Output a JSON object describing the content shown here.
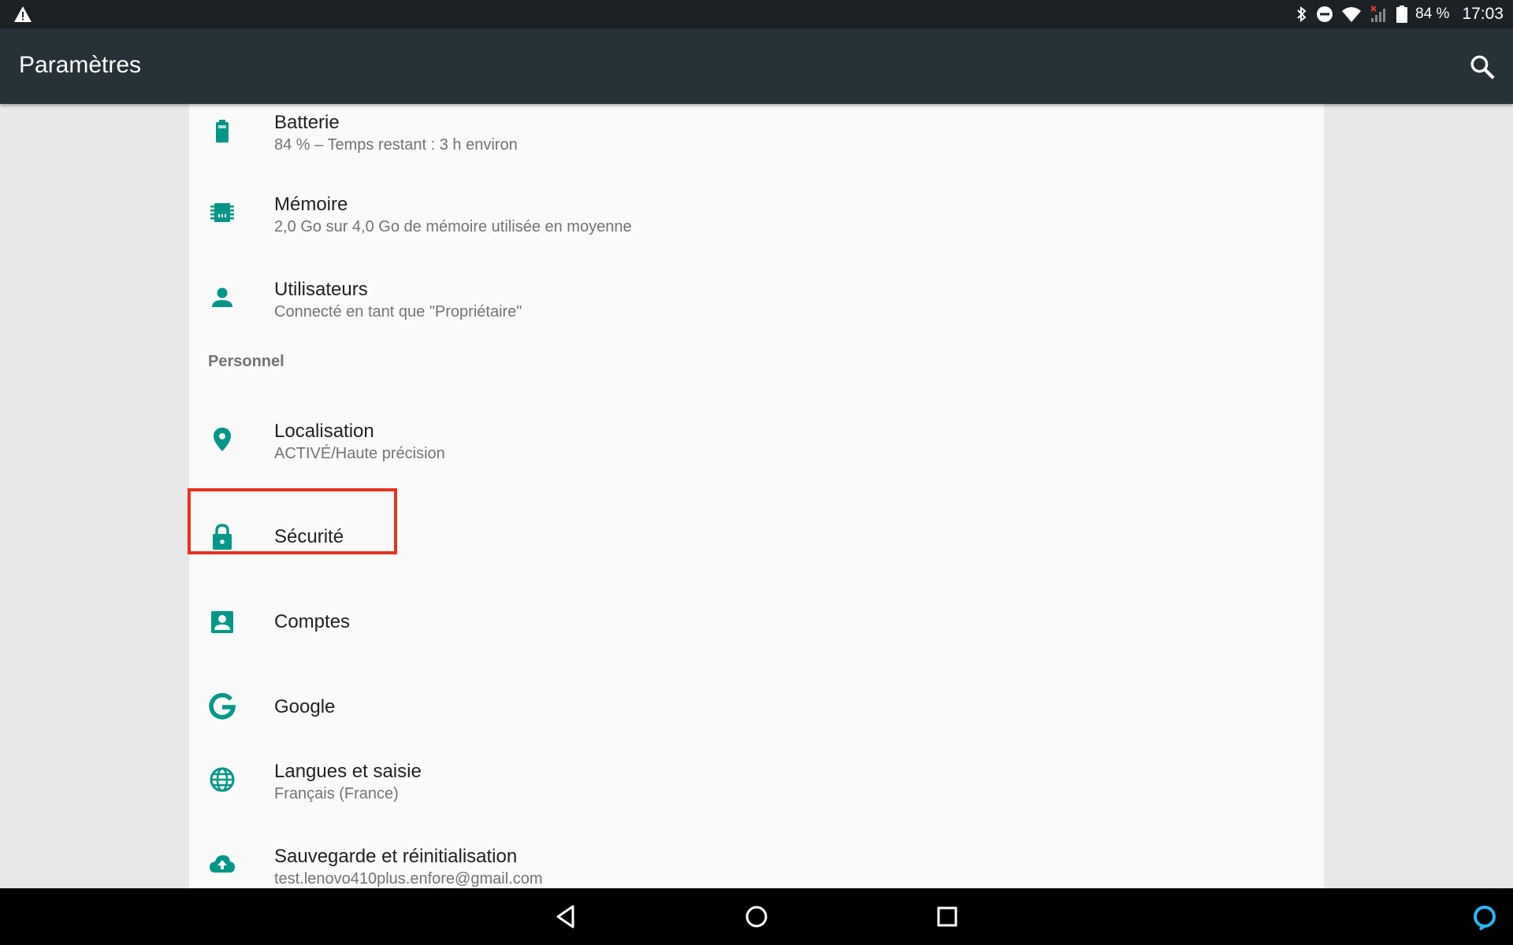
{
  "status_bar": {
    "battery_text": "84 %",
    "time": "17:03",
    "icons": [
      "warning-icon",
      "bluetooth-icon",
      "do-not-disturb-icon",
      "wifi-icon",
      "no-signal-icon",
      "battery-icon"
    ]
  },
  "app_bar": {
    "title": "Paramètres",
    "search_icon": "search-icon"
  },
  "settings": {
    "items": [
      {
        "id": "battery",
        "title": "Batterie",
        "subtitle": "84 % – Temps restant : 3 h environ",
        "icon": "battery-icon"
      },
      {
        "id": "memory",
        "title": "Mémoire",
        "subtitle": "2,0 Go sur 4,0 Go de mémoire utilisée en moyenne",
        "icon": "memory-icon"
      },
      {
        "id": "users",
        "title": "Utilisateurs",
        "subtitle": "Connecté en tant que \"Propriétaire\"",
        "icon": "person-icon"
      },
      {
        "id": "location",
        "title": "Localisation",
        "subtitle": "ACTIVÉ/Haute précision",
        "icon": "location-icon"
      },
      {
        "id": "security",
        "title": "Sécurité",
        "subtitle": "",
        "icon": "lock-icon"
      },
      {
        "id": "accounts",
        "title": "Comptes",
        "subtitle": "",
        "icon": "account-box-icon"
      },
      {
        "id": "google",
        "title": "Google",
        "subtitle": "",
        "icon": "google-icon"
      },
      {
        "id": "languages",
        "title": "Langues et saisie",
        "subtitle": "Français (France)",
        "icon": "globe-icon"
      },
      {
        "id": "backup",
        "title": "Sauvegarde et réinitialisation",
        "subtitle": "test.lenovo410plus.enfore@gmail.com",
        "icon": "cloud-upload-icon"
      }
    ],
    "section_personal": "Personnel"
  },
  "colors": {
    "accent": "#009688",
    "app_bar": "#263238",
    "status_bar": "#1b2125",
    "highlight": "#e8321e",
    "assistant": "#29b6f6"
  },
  "nav_bar": {
    "icons": [
      "back-icon",
      "home-icon",
      "recents-icon",
      "assistant-icon"
    ]
  }
}
